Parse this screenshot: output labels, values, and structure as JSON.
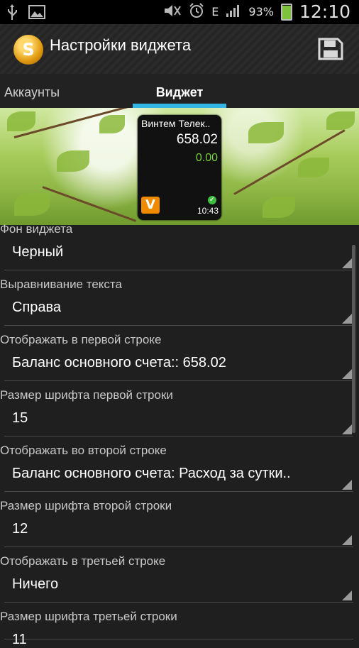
{
  "status_bar": {
    "icons_left": [
      "usb-icon",
      "image-icon"
    ],
    "icons_right": [
      "mute-icon",
      "alarm-icon",
      "edge-network-icon",
      "signal-icon"
    ],
    "network": "E",
    "battery": "93%",
    "battery_level": 0.93,
    "time": "12:10"
  },
  "action_bar": {
    "app_icon_glyph": "S",
    "title": "Настройки виджета",
    "save_icon": "save-icon"
  },
  "tabs": [
    {
      "label": "Аккаунты",
      "selected": false
    },
    {
      "label": "Виджет",
      "selected": true
    }
  ],
  "accent_color": "#33b5e5",
  "widget_preview": {
    "name": "Винтем Телек..",
    "value": "658.02",
    "change": "0.00",
    "logo_glyph": "V",
    "time": "10:43"
  },
  "settings": [
    {
      "label": "Фон виджета",
      "value": "Черный"
    },
    {
      "label": "Выравнивание текста",
      "value": "Справа"
    },
    {
      "label": "Отображать в первой строке",
      "value": "Баланс основного счета:: 658.02"
    },
    {
      "label": "Размер шрифта первой строки",
      "value": "15"
    },
    {
      "label": "Отображать во второй строке",
      "value": "Баланс основного счета: Расход за сутки.."
    },
    {
      "label": "Размер шрифта второй строки",
      "value": "12"
    },
    {
      "label": "Отображать в третьей строке",
      "value": "Ничего"
    },
    {
      "label": "Размер шрифта третьей строки",
      "value": "11"
    }
  ]
}
